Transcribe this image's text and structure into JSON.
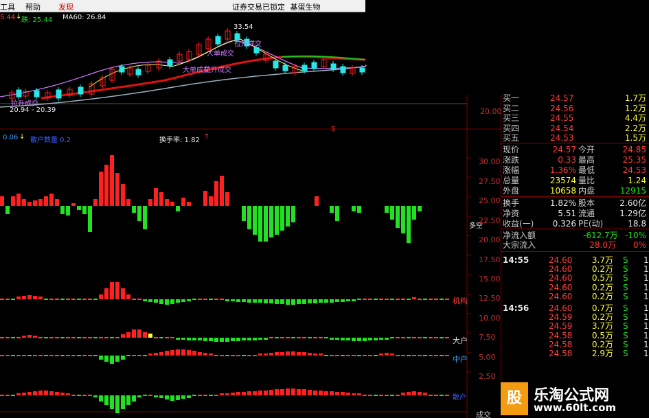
{
  "menu": {
    "items": [
      "工具",
      "帮助",
      "发现"
    ],
    "status": "证券交易已锁定",
    "stock_name": "基蛋生物"
  },
  "kline": {
    "legend_val": "5.44",
    "legend_down": "跌: 25.44",
    "legend_ma60": "MA60: 26.84",
    "high_label": "33.54",
    "low_label": "20.94 - 20.39",
    "axis_label": "20.00",
    "ann": [
      "大单成交",
      "拉升成交",
      "大单成交",
      "拉升成交",
      "拉升成交"
    ]
  },
  "indicator": {
    "legend_a": "0.06",
    "legend_b": "散户数量 0.2",
    "turnover": "换手率: 1.82",
    "marker": "5",
    "side_label": "多空",
    "axis": [
      "30.00",
      "27.50",
      "25.00",
      "22.50",
      "20.00",
      "17.50",
      "15.00",
      "12.50",
      "10.00",
      "7.50",
      "5.00",
      "2.50"
    ],
    "bottom_axis": "成交",
    "rows": [
      "机构",
      "大户",
      "中户",
      "散户"
    ]
  },
  "quotes": {
    "bids": [
      {
        "label": "买一",
        "price": "24.57",
        "vol": "1.7万"
      },
      {
        "label": "买二",
        "price": "24.56",
        "vol": "1.2万"
      },
      {
        "label": "买三",
        "price": "24.55",
        "vol": "4.4万"
      },
      {
        "label": "买四",
        "price": "24.54",
        "vol": "2.2万"
      },
      {
        "label": "买五",
        "price": "24.53",
        "vol": "1.5万"
      }
    ],
    "stats": [
      {
        "l1": "现价",
        "v1": "24.57",
        "l2": "今开",
        "v2": "24.85"
      },
      {
        "l1": "涨跌",
        "v1": "0.33",
        "l2": "最高",
        "v2": "25.35"
      },
      {
        "l1": "涨幅",
        "v1": "1.36%",
        "l2": "最低",
        "v2": "24.53"
      },
      {
        "l1": "总量",
        "v1": "23574",
        "l2": "量比",
        "v2": "1.24"
      },
      {
        "l1": "外盘",
        "v1": "10658",
        "l2": "内盘",
        "v2": "12915"
      }
    ],
    "fund": [
      {
        "l1": "换手",
        "v1": "1.82%",
        "l2": "股本",
        "v2": "2.60亿"
      },
      {
        "l1": "净资",
        "v1": "5.51",
        "l2": "流通",
        "v2": "1.29亿"
      },
      {
        "l1": "收益(一)",
        "v1": "0.326",
        "l2": "PE(动)",
        "v2": "18.8"
      }
    ],
    "flow": [
      {
        "label": "净流入额",
        "value": "-612.7万",
        "pct": "-10%"
      },
      {
        "label": "大宗流入",
        "value": "28.0万",
        "pct": "0%"
      }
    ],
    "ticks": [
      {
        "time": "14:55",
        "price": "24.60",
        "vol": "3.7万",
        "bs": "S",
        "n": "1"
      },
      {
        "time": "",
        "price": "24.60",
        "vol": "0.2万",
        "bs": "S",
        "n": "1"
      },
      {
        "time": "",
        "price": "24.60",
        "vol": "0.5万",
        "bs": "S",
        "n": "1"
      },
      {
        "time": "",
        "price": "24.60",
        "vol": "0.2万",
        "bs": "S",
        "n": "1"
      },
      {
        "time": "",
        "price": "24.60",
        "vol": "0.2万",
        "bs": "S",
        "n": "1"
      },
      {
        "time": "14:56",
        "price": "24.60",
        "vol": "0.7万",
        "bs": "S",
        "n": "1"
      },
      {
        "time": "",
        "price": "24.59",
        "vol": "0.2万",
        "bs": "S",
        "n": "1"
      },
      {
        "time": "",
        "price": "24.59",
        "vol": "3.7万",
        "bs": "S",
        "n": "1"
      },
      {
        "time": "",
        "price": "24.58",
        "vol": "0.5万",
        "bs": "S",
        "n": "1"
      },
      {
        "time": "",
        "price": "24.58",
        "vol": "0.2万",
        "bs": "S",
        "n": "1"
      },
      {
        "time": "",
        "price": "24.58",
        "vol": "2.9万",
        "bs": "S",
        "n": "1"
      }
    ]
  },
  "watermark": {
    "logo": "股",
    "title": "乐淘公式网",
    "url": "www.60lt.com"
  },
  "colors": {
    "up": "#ff2020",
    "down": "#22e022",
    "highlight": "#ffff33",
    "ma_red": "#e01010",
    "ma_green": "#22c022",
    "ma_white": "#9ab0c0",
    "ma_purple": "#d07aff",
    "grid": "#7a0000"
  }
}
